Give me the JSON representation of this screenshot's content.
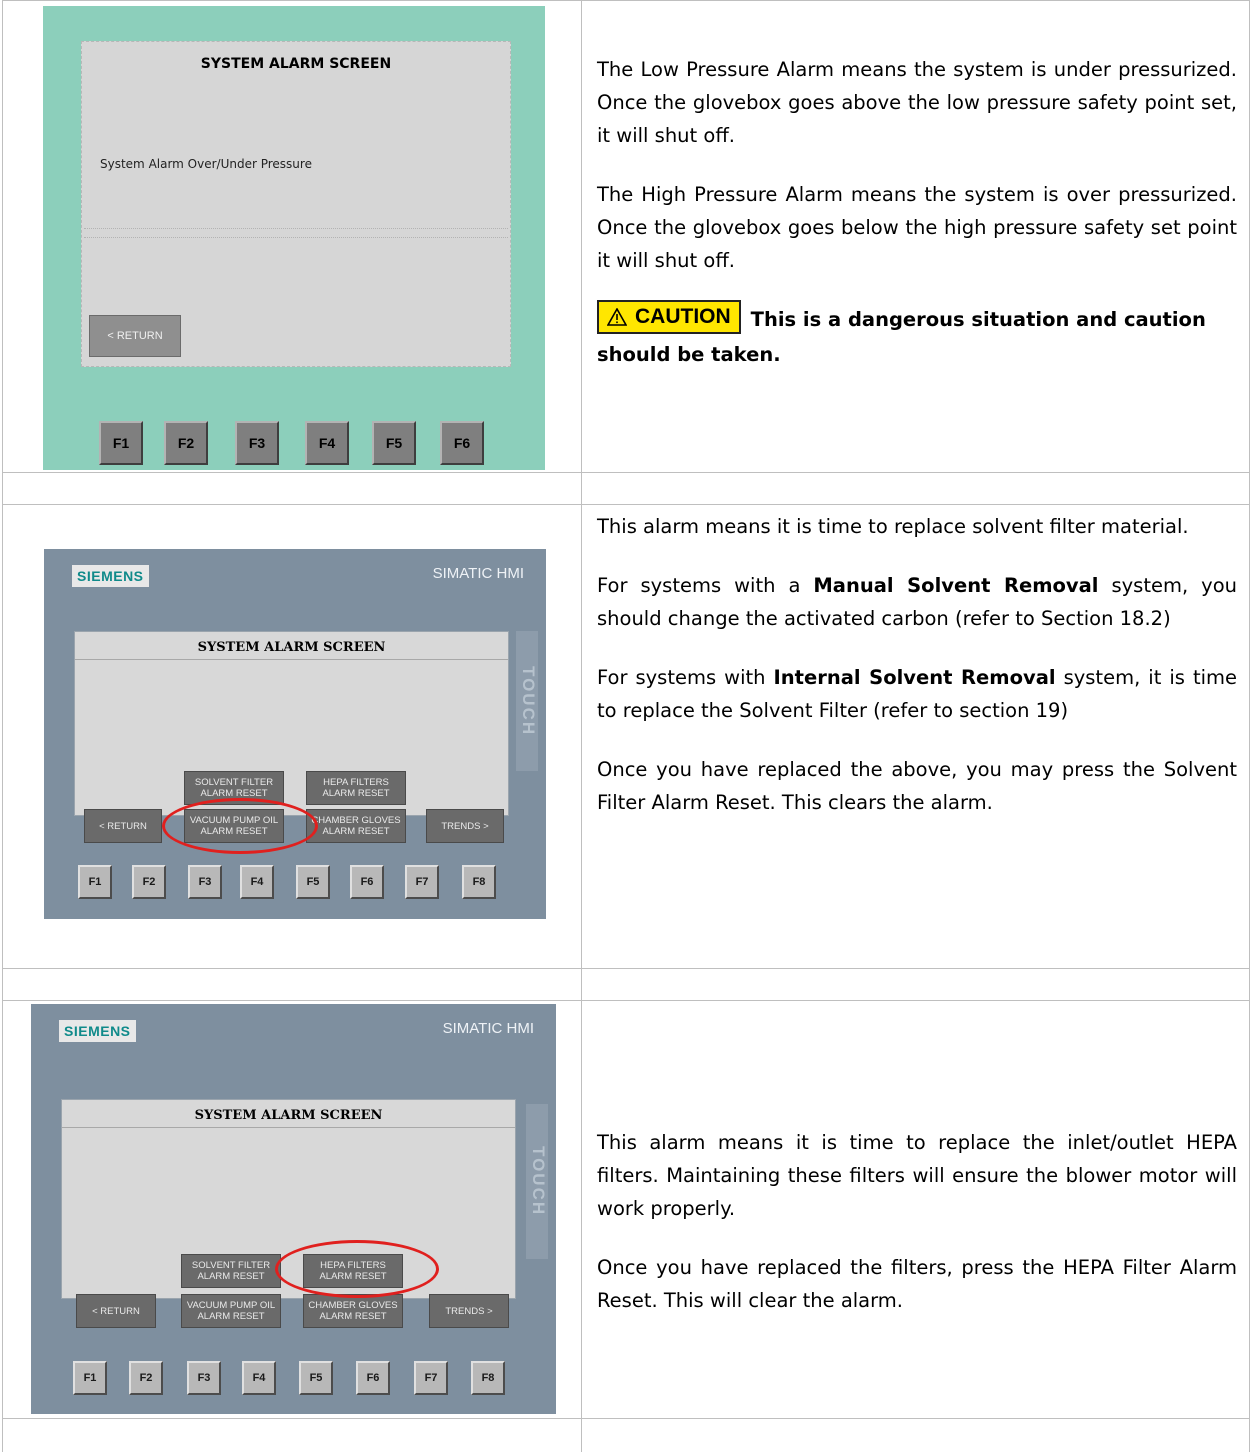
{
  "row1": {
    "screen_title": "SYSTEM ALARM SCREEN",
    "screen_message": "System Alarm Over/Under Pressure",
    "return_label": "< RETURN",
    "fkeys": [
      "F1",
      "F2",
      "F3",
      "F4",
      "F5",
      "F6"
    ],
    "para1": "The Low Pressure Alarm means the system is under pressurized. Once the glovebox goes above the low pressure safety point set, it will shut off.",
    "para2": "The High Pressure Alarm means the system is over pressurized. Once the glovebox goes below the high pressure safety set point it will shut off.",
    "caution_label": "CAUTION",
    "caution_text": "This is a dangerous situation and caution should be taken."
  },
  "row2": {
    "brand": "SIEMENS",
    "hmi": "SIMATIC HMI",
    "touch": "TOUCH",
    "screen_title": "SYSTEM ALARM SCREEN",
    "btn_solvent": "SOLVENT FILTER ALARM RESET",
    "btn_hepa": "HEPA FILTERS ALARM RESET",
    "btn_return": "< RETURN",
    "btn_vacuum": "VACUUM PUMP OIL ALARM RESET",
    "btn_gloves": "CHAMBER GLOVES ALARM RESET",
    "btn_trends": "TRENDS >",
    "fkeys": [
      "F1",
      "F2",
      "F3",
      "F4",
      "F5",
      "F6",
      "F7",
      "F8"
    ],
    "para1": "This alarm means it is time to replace solvent filter material.",
    "para2_pre": "For systems with a ",
    "para2_bold": "Manual Solvent Removal",
    "para2_post": " system, you should change the activated carbon (refer to Section 18.2)",
    "para3_pre": "For systems with ",
    "para3_bold": "Internal Solvent Removal",
    "para3_post": " system, it is time to replace the Solvent Filter (refer to section 19)",
    "para4": "Once you have replaced the above, you may press the Solvent Filter Alarm Reset. This clears the alarm."
  },
  "row3": {
    "brand": "SIEMENS",
    "hmi": "SIMATIC HMI",
    "touch": "TOUCH",
    "screen_title": "SYSTEM ALARM SCREEN",
    "btn_solvent": "SOLVENT FILTER ALARM RESET",
    "btn_hepa": "HEPA FILTERS ALARM RESET",
    "btn_return": "< RETURN",
    "btn_vacuum": "VACUUM PUMP OIL ALARM RESET",
    "btn_gloves": "CHAMBER GLOVES ALARM RESET",
    "btn_trends": "TRENDS >",
    "fkeys": [
      "F1",
      "F2",
      "F3",
      "F4",
      "F5",
      "F6",
      "F7",
      "F8"
    ],
    "para1": "This alarm means it is time to replace the inlet/outlet HEPA filters. Maintaining these filters will ensure the blower motor will work properly.",
    "para2": "Once you have replaced the filters, press the HEPA Filter Alarm Reset. This will clear the alarm."
  },
  "colors": {
    "teal_panel": "#8ccfbb",
    "siemens_panel": "#7e8f9f",
    "caution_yellow": "#ffe600",
    "highlight_red": "#e0201e"
  }
}
